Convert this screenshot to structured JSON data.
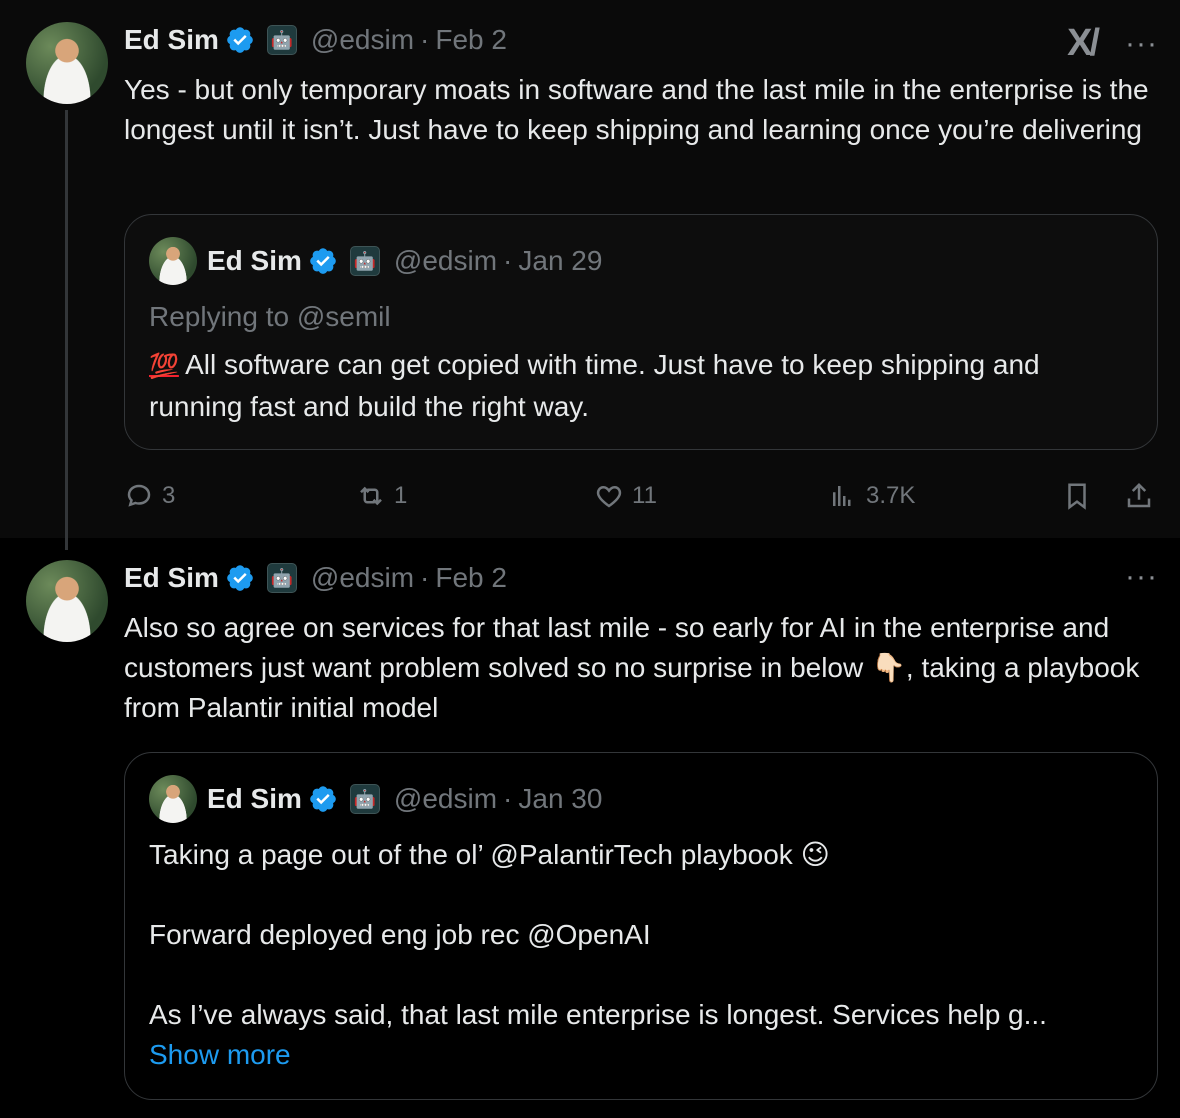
{
  "tweets": [
    {
      "author": {
        "name": "Ed Sim",
        "handle": "@edsim",
        "verified": true,
        "badge_icon": "ai-bot-badge-icon"
      },
      "separator": "·",
      "date": "Feb 2",
      "text": "Yes - but only temporary moats in software and the last mile in the enterprise is the longest until it isn’t. Just have to keep shipping and learning once you’re delivering",
      "quote": {
        "author": {
          "name": "Ed Sim",
          "handle": "@edsim"
        },
        "separator": "·",
        "date": "Jan 29",
        "replying_to": "Replying to @semil",
        "emoji": "💯",
        "text": "All software can get copied with time. Just have to keep shipping and running fast and build the right way."
      },
      "actions": {
        "replies": "3",
        "reposts": "1",
        "likes": "11",
        "views": "3.7K"
      }
    },
    {
      "author": {
        "name": "Ed Sim",
        "handle": "@edsim",
        "verified": true
      },
      "separator": "·",
      "date": "Feb 2",
      "text_part1": "Also so agree on services for that last mile - so early for AI in the enterprise and customers just want problem solved so no surprise in below",
      "emoji_point": "👇🏻",
      "text_part2": ", taking a playbook from Palantir initial model",
      "quote": {
        "author": {
          "name": "Ed Sim",
          "handle": "@edsim"
        },
        "separator": "·",
        "date": "Jan 30",
        "line1": "Taking a page out of the ol’ @PalantirTech playbook",
        "emoji_wink": "😉",
        "line2": "Forward deployed eng job rec @OpenAI",
        "line3": "As I’ve always said, that last mile enterprise is longest. Services help g...",
        "show_more": "Show more"
      }
    }
  ],
  "colors": {
    "background": "#000000",
    "text": "#e7e9ea",
    "muted": "#71767b",
    "link": "#1d9bf0",
    "verified": "#1d9bf0",
    "border": "#333639"
  }
}
